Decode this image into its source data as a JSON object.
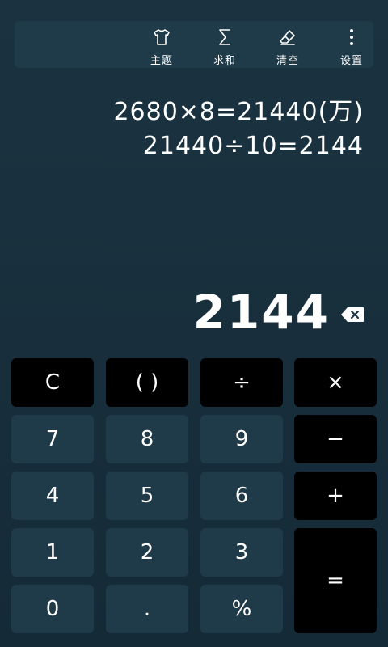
{
  "toolbar": {
    "items": [
      {
        "label": "主题",
        "icon": "shirt-icon"
      },
      {
        "label": "求和",
        "icon": "sigma-icon"
      },
      {
        "label": "清空",
        "icon": "eraser-icon"
      },
      {
        "label": "设置",
        "icon": "more-vertical-icon"
      }
    ]
  },
  "history": [
    "2680×8=21440(万)",
    "21440÷10=2144"
  ],
  "display": {
    "result": "2144",
    "backspace_icon": "backspace-icon"
  },
  "keypad": {
    "clear": "C",
    "parens": "( )",
    "divide": "÷",
    "multiply": "×",
    "seven": "7",
    "eight": "8",
    "nine": "9",
    "minus": "−",
    "four": "4",
    "five": "5",
    "six": "6",
    "plus": "+",
    "one": "1",
    "two": "2",
    "three": "3",
    "equals": "=",
    "zero": "0",
    "dot": ".",
    "percent": "%"
  },
  "colors": {
    "background": "#1b3341",
    "panel": "#1f3a48",
    "operator_key": "#000000",
    "text": "#ffffff"
  }
}
